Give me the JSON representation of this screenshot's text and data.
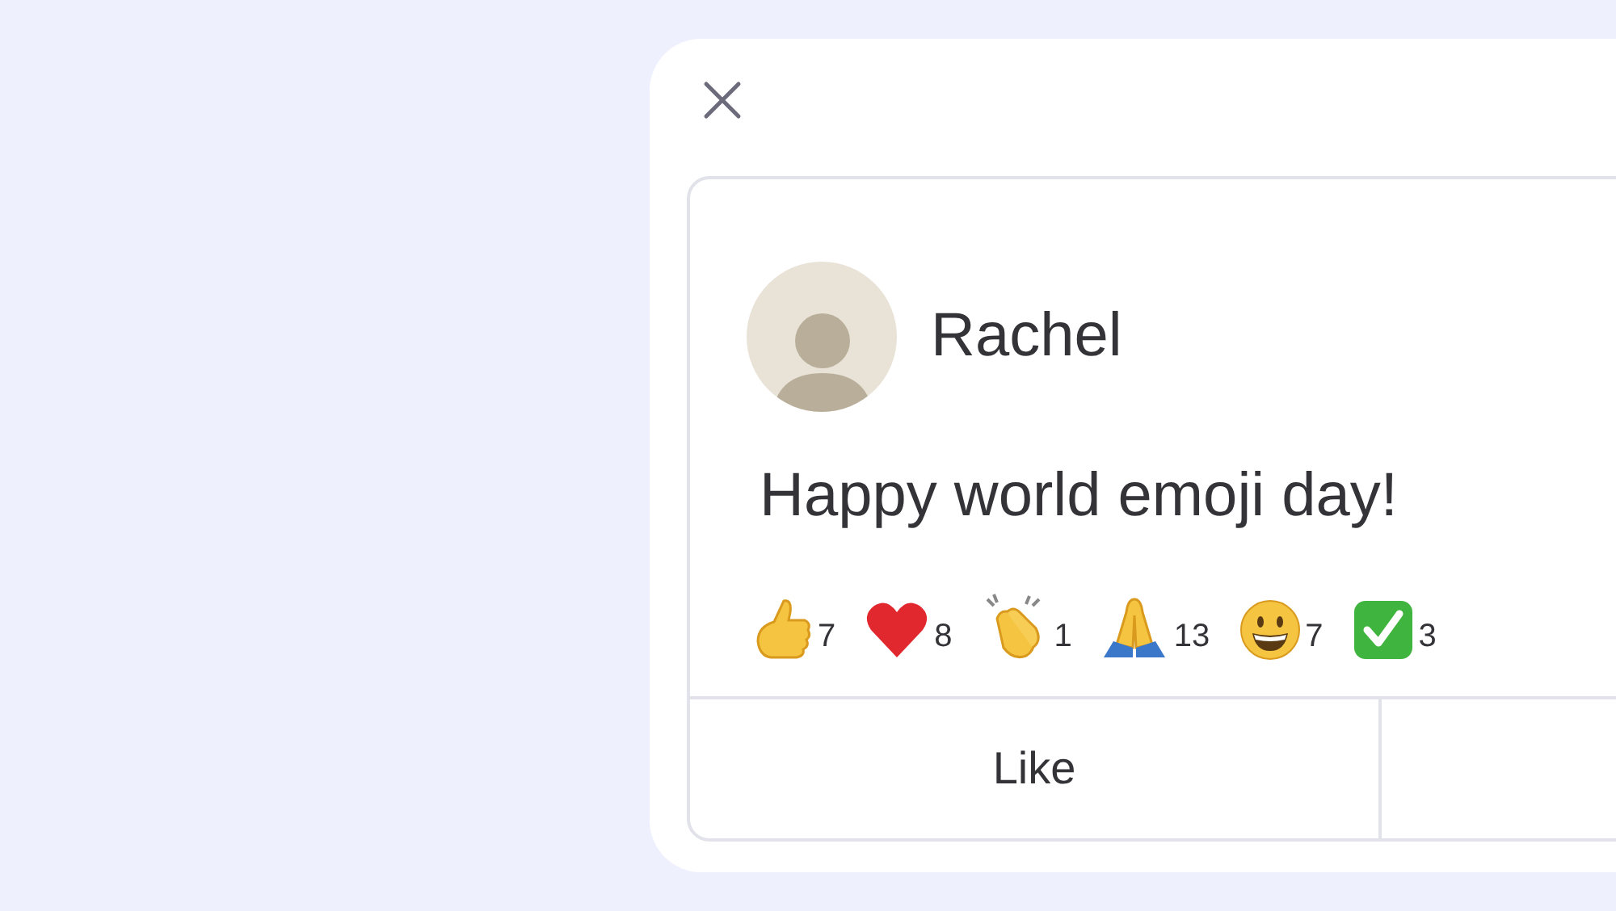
{
  "post": {
    "author": "Rachel",
    "message": "Happy world emoji day!",
    "reactions": [
      {
        "kind": "thumbs_up",
        "count": "7"
      },
      {
        "kind": "heart",
        "count": "8"
      },
      {
        "kind": "clap",
        "count": "1"
      },
      {
        "kind": "pray",
        "count": "13"
      },
      {
        "kind": "grin",
        "count": "7"
      },
      {
        "kind": "check",
        "count": "3"
      }
    ],
    "actions": [
      "Like"
    ]
  }
}
